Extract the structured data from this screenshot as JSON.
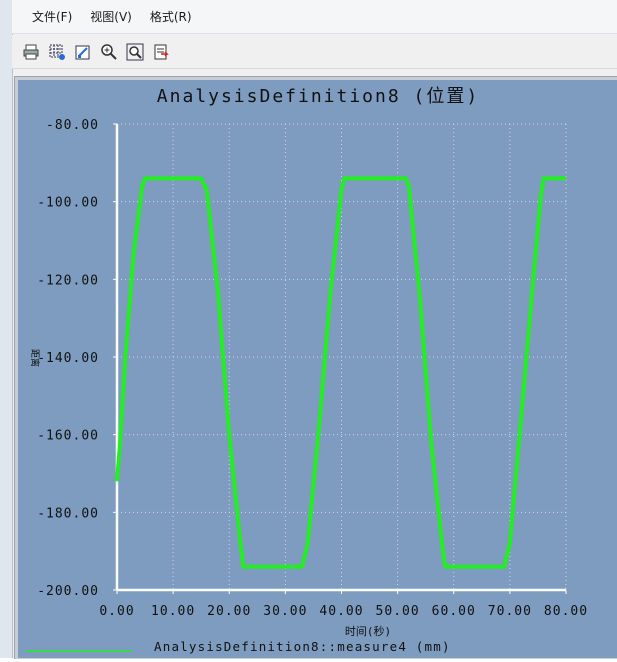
{
  "menu": {
    "items": [
      "文件(F)",
      "视图(V)",
      "格式(R)"
    ]
  },
  "toolbar": {
    "icons": [
      "print-icon",
      "grid-icon",
      "edit-axes-icon",
      "zoom-in-icon",
      "zoom-fit-icon",
      "export-icon"
    ]
  },
  "colors": {
    "plot_bg": "#7e9cbf",
    "axis": "#ffffff",
    "series": "#22ee22",
    "text": "#111111"
  },
  "chart_data": {
    "type": "line",
    "title": "AnalysisDefinition8 (位置)",
    "xlabel": "时间(秒)",
    "ylabel": "距离",
    "xlim": [
      0,
      80
    ],
    "ylim": [
      -200,
      -80
    ],
    "x_ticks": [
      "0.00",
      "10.00",
      "20.00",
      "30.00",
      "40.00",
      "50.00",
      "60.00",
      "70.00",
      "80.00"
    ],
    "y_ticks": [
      "-80.00",
      "-100.00",
      "-120.00",
      "-140.00",
      "-160.00",
      "-180.00",
      "-200.00"
    ],
    "grid": true,
    "legend_position": "bottom-left",
    "series": [
      {
        "name": "AnalysisDefinition8::measure4 (mm)",
        "x": [
          0,
          0.5,
          1.5,
          3,
          4.5,
          5,
          15,
          16,
          18,
          20,
          22,
          22.5,
          33,
          34,
          36,
          38,
          40,
          40.5,
          51.5,
          52,
          54,
          56,
          58,
          58.5,
          69,
          70,
          72,
          74,
          75.5,
          76,
          80
        ],
        "y": [
          -172,
          -163,
          -140,
          -113,
          -96,
          -94,
          -94,
          -97,
          -123,
          -160,
          -188,
          -194,
          -194,
          -188,
          -158,
          -124,
          -97,
          -94,
          -94,
          -96,
          -125,
          -162,
          -189,
          -194,
          -194,
          -188,
          -156,
          -123,
          -99,
          -94,
          -94
        ]
      }
    ]
  }
}
